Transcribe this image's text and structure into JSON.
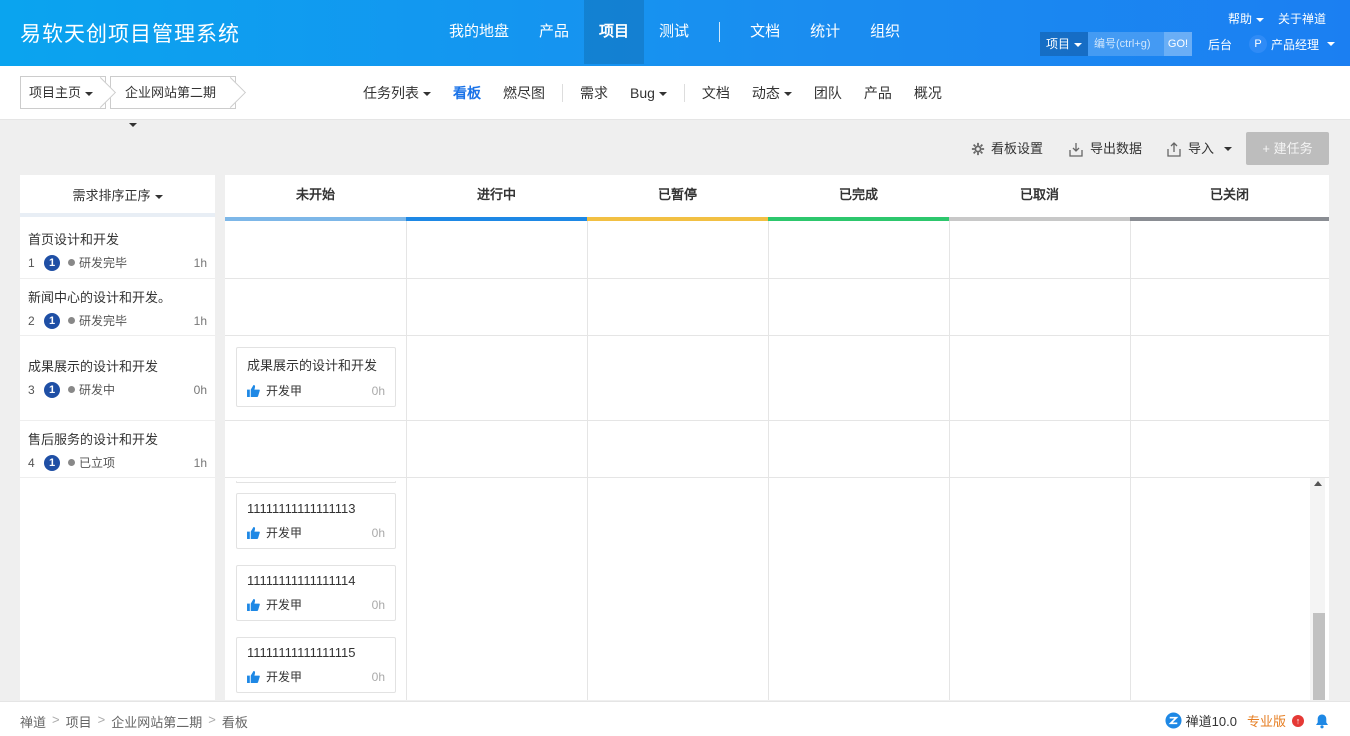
{
  "header": {
    "brand": "易软天创项目管理系统",
    "nav": [
      {
        "label": "我的地盘",
        "active": false
      },
      {
        "label": "产品",
        "active": false
      },
      {
        "label": "项目",
        "active": true
      },
      {
        "label": "测试",
        "active": false
      }
    ],
    "nav2": [
      {
        "label": "文档"
      },
      {
        "label": "统计"
      },
      {
        "label": "组织"
      }
    ],
    "help": "帮助",
    "about": "关于禅道",
    "search_type": "项目",
    "search_placeholder": "编号(ctrl+g)",
    "go": "GO!",
    "admin": "后台",
    "user_initial": "P",
    "user_role": "产品经理"
  },
  "subnav": {
    "crumb_home": "项目主页",
    "crumb_project": "企业网站第二期",
    "menu": {
      "tasks": "任务列表",
      "kanban": "看板",
      "burndown": "燃尽图",
      "story": "需求",
      "bug": "Bug",
      "doc": "文档",
      "dynamic": "动态",
      "team": "团队",
      "product": "产品",
      "overview": "概况"
    }
  },
  "toolbar": {
    "settings": "看板设置",
    "export": "导出数据",
    "import": "导入",
    "create": "+ 建任务"
  },
  "left": {
    "sort_label": "需求排序正序",
    "stories": [
      {
        "title": "首页设计和开发",
        "index": "1",
        "pri": "1",
        "status": "研发完毕",
        "estimate": "1h"
      },
      {
        "title": "新闻中心的设计和开发。",
        "index": "2",
        "pri": "1",
        "status": "研发完毕",
        "estimate": "1h"
      },
      {
        "title": "成果展示的设计和开发",
        "index": "3",
        "pri": "1",
        "status": "研发中",
        "estimate": "0h"
      },
      {
        "title": "售后服务的设计和开发",
        "index": "4",
        "pri": "1",
        "status": "已立项",
        "estimate": "1h"
      }
    ]
  },
  "columns": [
    {
      "label": "未开始",
      "color": "#7db7e8"
    },
    {
      "label": "进行中",
      "color": "#1e88e5"
    },
    {
      "label": "已暂停",
      "color": "#f2c043"
    },
    {
      "label": "已完成",
      "color": "#2dc76d"
    },
    {
      "label": "已取消",
      "color": "#c8c8c8"
    },
    {
      "label": "已关闭",
      "color": "#8a8d93"
    }
  ],
  "cards": [
    {
      "title": "成果展示的设计和开发",
      "assignee": "开发甲",
      "estimate": "0h"
    },
    {
      "title": "11111111111111113",
      "assignee": "开发甲",
      "estimate": "0h"
    },
    {
      "title": "11111111111111114",
      "assignee": "开发甲",
      "estimate": "0h"
    },
    {
      "title": "11111111111111115",
      "assignee": "开发甲",
      "estimate": "0h"
    }
  ],
  "footer": {
    "breadcrumb": [
      "禅道",
      "项目",
      "企业网站第二期",
      "看板"
    ],
    "version": "禅道10.0",
    "edition": "专业版"
  }
}
